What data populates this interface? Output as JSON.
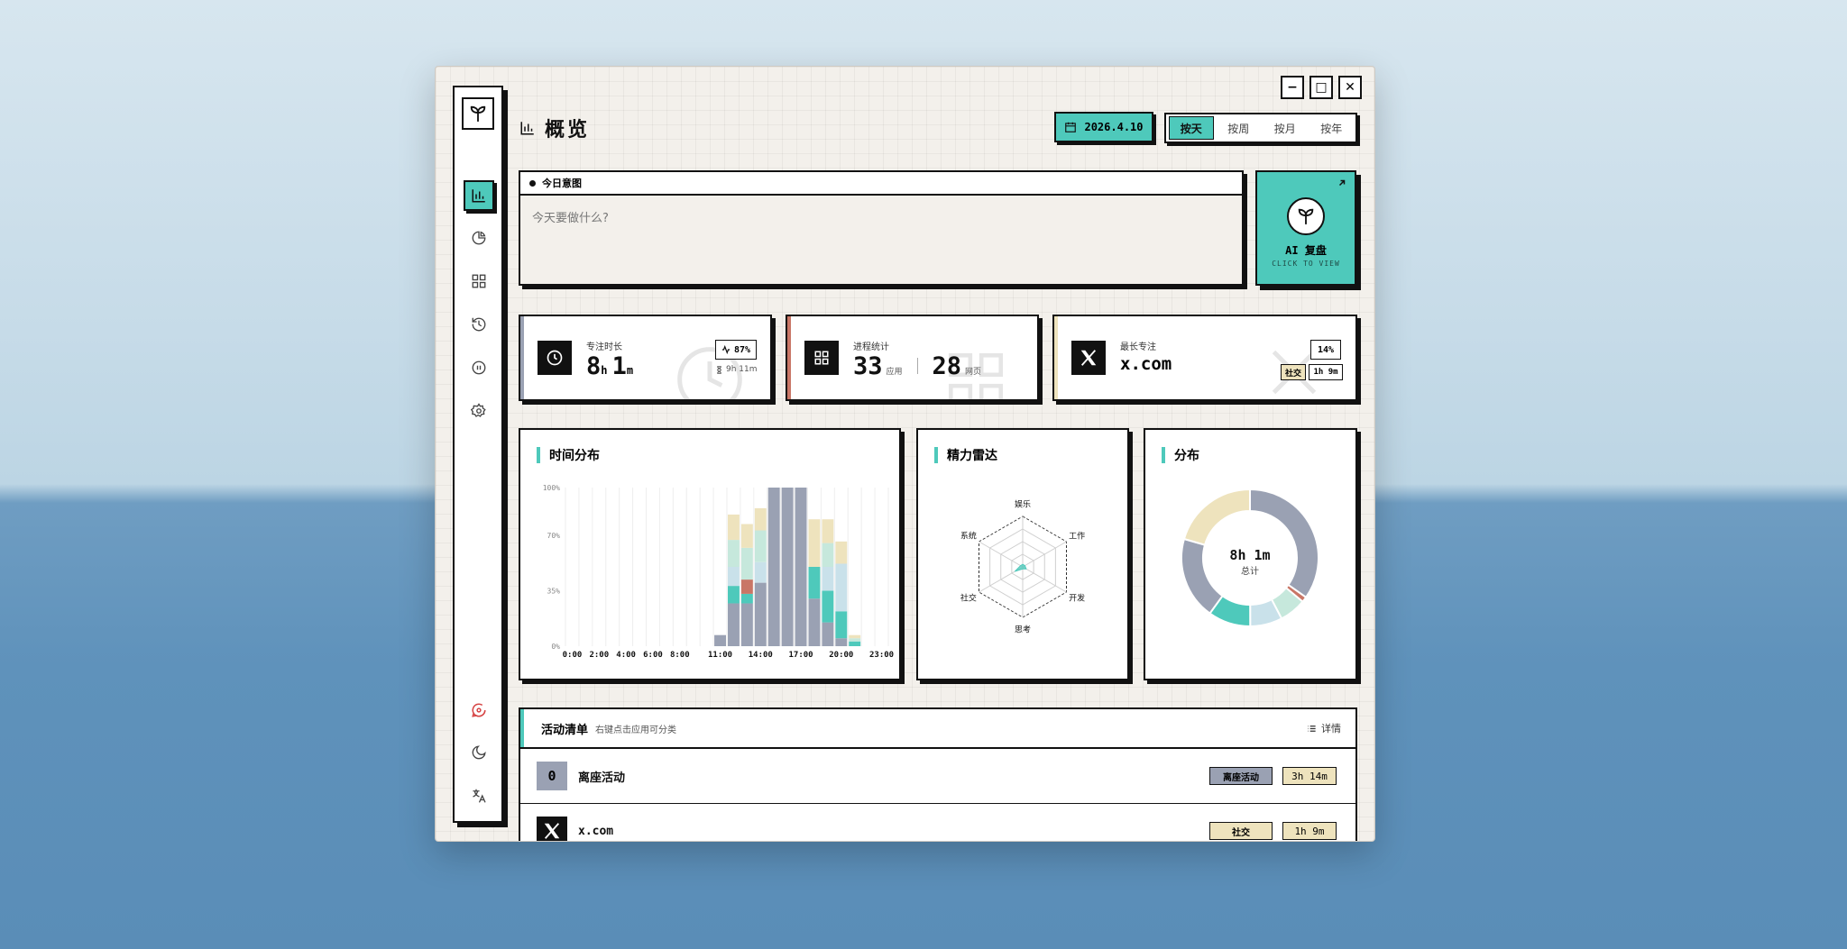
{
  "window_controls": {
    "minimize": "−",
    "maximize": "□",
    "close": "✕"
  },
  "header": {
    "title": "概览",
    "date_label": "2026.4.10",
    "segments": [
      "按天",
      "按周",
      "按月",
      "按年"
    ],
    "active_segment": 0
  },
  "intent": {
    "title": "今日意图",
    "placeholder": "今天要做什么?"
  },
  "ai_card": {
    "title": "AI 复盘",
    "subtitle": "CLICK TO VIEW"
  },
  "stats": {
    "focus": {
      "label": "专注时长",
      "hours": "8",
      "h_unit": "h",
      "minutes": "1",
      "m_unit": "m",
      "badge": "87%",
      "sub": "9h 11m"
    },
    "process": {
      "label": "进程统计",
      "apps": "33",
      "apps_unit": "应用",
      "pages": "28",
      "pages_unit": "网页"
    },
    "longest": {
      "label": "最长专注",
      "name": "x.com",
      "percent": "14%",
      "tag": "社交",
      "duration": "1h 9m"
    }
  },
  "colors": {
    "accent": "#4ec9bb",
    "gray": "#9aa1b3",
    "cream": "#eee3bd",
    "mint": "#c6e8dc",
    "lightblue": "#c9e1ea",
    "red": "#c97666"
  },
  "cards": {
    "time_dist": "时间分布",
    "radar": "精力雷达",
    "donut": "分布",
    "donut_center": "8h 1m",
    "donut_sub": "总计"
  },
  "chart_data": [
    {
      "type": "bar",
      "title": "时间分布",
      "stacked": true,
      "percent_scale": true,
      "categories": [
        "0:00",
        "1:00",
        "2:00",
        "3:00",
        "4:00",
        "5:00",
        "6:00",
        "7:00",
        "8:00",
        "9:00",
        "10:00",
        "11:00",
        "12:00",
        "13:00",
        "14:00",
        "15:00",
        "16:00",
        "17:00",
        "18:00",
        "19:00",
        "20:00",
        "21:00",
        "22:00",
        "23:00"
      ],
      "x_tick_labels": [
        "0:00",
        "2:00",
        "4:00",
        "6:00",
        "8:00",
        "11:00",
        "14:00",
        "17:00",
        "20:00",
        "23:00"
      ],
      "y_tick_labels": [
        "0%",
        "35%",
        "70%",
        "100%"
      ],
      "ylim": [
        0,
        100
      ],
      "grid": true,
      "series": [
        {
          "color": "#9aa1b3",
          "values": [
            0,
            0,
            0,
            0,
            0,
            0,
            0,
            0,
            0,
            0,
            0,
            7,
            27,
            27,
            40,
            100,
            100,
            100,
            30,
            15,
            5,
            0,
            0,
            0
          ]
        },
        {
          "color": "#4ec9bb",
          "values": [
            0,
            0,
            0,
            0,
            0,
            0,
            0,
            0,
            0,
            0,
            0,
            0,
            11,
            6,
            0,
            0,
            0,
            0,
            20,
            20,
            17,
            3,
            0,
            0
          ]
        },
        {
          "color": "#c97666",
          "values": [
            0,
            0,
            0,
            0,
            0,
            0,
            0,
            0,
            0,
            0,
            0,
            0,
            0,
            9,
            0,
            0,
            0,
            0,
            0,
            0,
            0,
            0,
            0,
            0
          ]
        },
        {
          "color": "#c9e1ea",
          "values": [
            0,
            0,
            0,
            0,
            0,
            0,
            0,
            0,
            0,
            0,
            0,
            0,
            12,
            0,
            13,
            0,
            0,
            0,
            0,
            15,
            30,
            0,
            0,
            0
          ]
        },
        {
          "color": "#c6e8dc",
          "values": [
            0,
            0,
            0,
            0,
            0,
            0,
            0,
            0,
            0,
            0,
            0,
            0,
            17,
            20,
            20,
            0,
            0,
            0,
            0,
            15,
            0,
            2,
            0,
            0
          ]
        },
        {
          "color": "#eee3bd",
          "values": [
            0,
            0,
            0,
            0,
            0,
            0,
            0,
            0,
            0,
            0,
            0,
            0,
            16,
            15,
            14,
            0,
            0,
            0,
            30,
            15,
            14,
            2,
            0,
            0
          ]
        }
      ]
    },
    {
      "type": "radar",
      "title": "精力雷达",
      "axes": [
        "娱乐",
        "工作",
        "开发",
        "思考",
        "社交",
        "系统"
      ],
      "values": [
        0.05,
        0.05,
        0.08,
        0.04,
        0.18,
        0.05
      ],
      "max": 1
    },
    {
      "type": "pie",
      "donut": true,
      "title": "分布",
      "center_text": "8h 1m",
      "center_sub": "总计",
      "slices": [
        {
          "value": 0.33,
          "color": "#9aa1b3"
        },
        {
          "value": 0.012,
          "color": "#c97666"
        },
        {
          "value": 0.06,
          "color": "#c6e8dc"
        },
        {
          "value": 0.072,
          "color": "#c9e1ea"
        },
        {
          "value": 0.095,
          "color": "#4ec9bb"
        },
        {
          "value": 0.185,
          "color": "#9aa1b3"
        },
        {
          "value": 0.195,
          "color": "#eee3bd"
        }
      ]
    }
  ],
  "activity": {
    "title": "活动清单",
    "hint": "右键点击应用可分类",
    "detail": "详情",
    "rows": [
      {
        "icon_text": "0",
        "name": "离座活动",
        "tag": "离座活动",
        "duration": "3h 14m"
      },
      {
        "name": "x.com",
        "tag": "社交",
        "duration": "1h 9m"
      }
    ]
  }
}
